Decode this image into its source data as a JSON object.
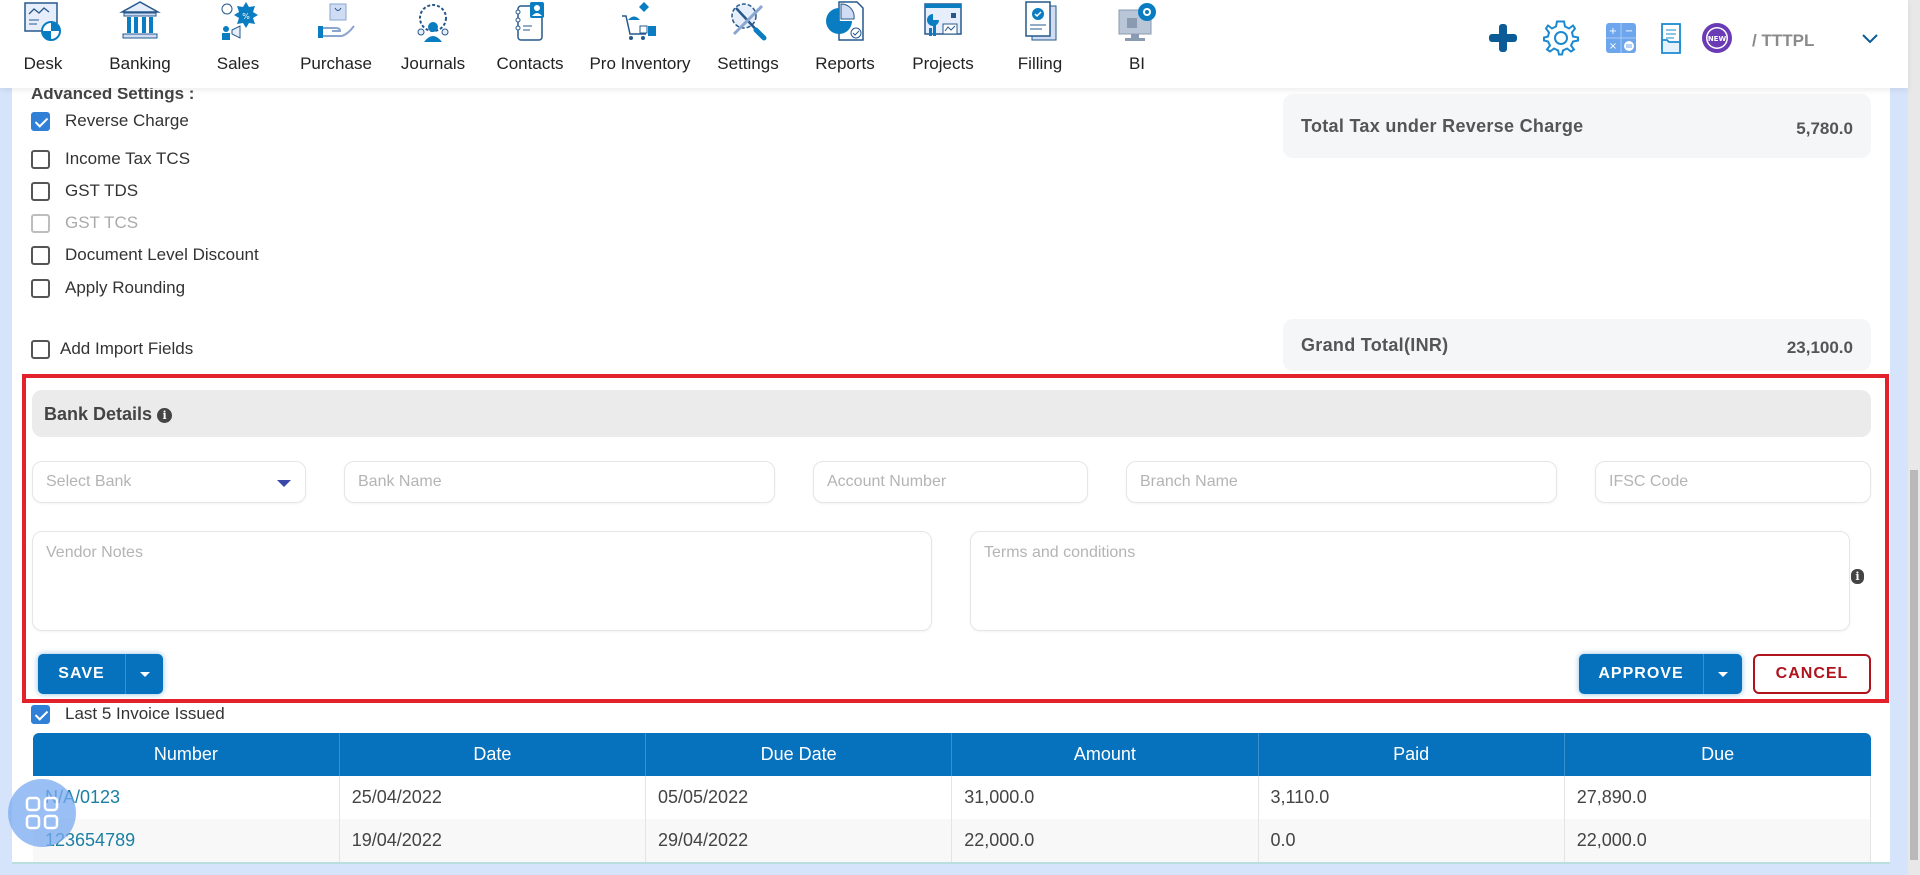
{
  "nav": {
    "items": [
      {
        "label": "Desk",
        "icon": "desk-icon"
      },
      {
        "label": "Banking",
        "icon": "bank-icon"
      },
      {
        "label": "Sales",
        "icon": "sales-icon"
      },
      {
        "label": "Purchase",
        "icon": "purchase-icon"
      },
      {
        "label": "Journals",
        "icon": "journals-icon"
      },
      {
        "label": "Contacts",
        "icon": "contacts-icon"
      },
      {
        "label": "Pro Inventory",
        "icon": "inventory-icon"
      },
      {
        "label": "Settings",
        "icon": "settings-icon"
      },
      {
        "label": "Reports",
        "icon": "reports-icon"
      },
      {
        "label": "Projects",
        "icon": "projects-icon"
      },
      {
        "label": "Filling",
        "icon": "filling-icon"
      },
      {
        "label": "BI",
        "icon": "bi-icon"
      }
    ],
    "right_icons": [
      "plus-icon",
      "gear-icon",
      "calculator-icon",
      "documents-icon",
      "new-badge-icon"
    ],
    "new_badge_text": "NEW",
    "company": "/ TTTPL",
    "menu_chevron": "chevron-down-icon"
  },
  "advanced_settings": {
    "title": "Advanced Settings :",
    "options": [
      {
        "label": "Reverse Charge",
        "checked": true,
        "disabled": false
      },
      {
        "label": "Income Tax TCS",
        "checked": false,
        "disabled": false
      },
      {
        "label": "GST TDS",
        "checked": false,
        "disabled": false
      },
      {
        "label": "GST TCS",
        "checked": false,
        "disabled": true
      },
      {
        "label": "Document Level Discount",
        "checked": false,
        "disabled": false
      },
      {
        "label": "Apply Rounding",
        "checked": false,
        "disabled": false
      }
    ],
    "import_fields": {
      "label": "Add Import Fields",
      "checked": false
    }
  },
  "totals": {
    "reverse_charge": {
      "label": "Total Tax under Reverse Charge",
      "value": "5,780.0"
    },
    "grand_total": {
      "label": "Grand Total(INR)",
      "value": "23,100.0"
    }
  },
  "bank_details": {
    "title": "Bank Details",
    "select_bank_placeholder": "Select Bank",
    "bank_name_placeholder": "Bank Name",
    "account_number_placeholder": "Account Number",
    "branch_name_placeholder": "Branch Name",
    "ifsc_placeholder": "IFSC Code",
    "vendor_notes_placeholder": "Vendor Notes",
    "terms_placeholder": "Terms and conditions"
  },
  "actions": {
    "save": "SAVE",
    "approve": "APPROVE",
    "cancel": "CANCEL"
  },
  "invoices": {
    "toggle_label": "Last 5 Invoice Issued",
    "toggle_checked": true,
    "columns": [
      "Number",
      "Date",
      "Due Date",
      "Amount",
      "Paid",
      "Due"
    ],
    "rows": [
      [
        "N/A/0123",
        "25/04/2022",
        "05/05/2022",
        "31,000.0",
        "3,110.0",
        "27,890.0"
      ],
      [
        "123654789",
        "19/04/2022",
        "29/04/2022",
        "22,000.0",
        "0.0",
        "22,000.0"
      ]
    ]
  },
  "colors": {
    "primary": "#0671bd",
    "danger": "#b0131c",
    "highlight_border": "#e2212b",
    "checkbox": "#2f80d6"
  }
}
